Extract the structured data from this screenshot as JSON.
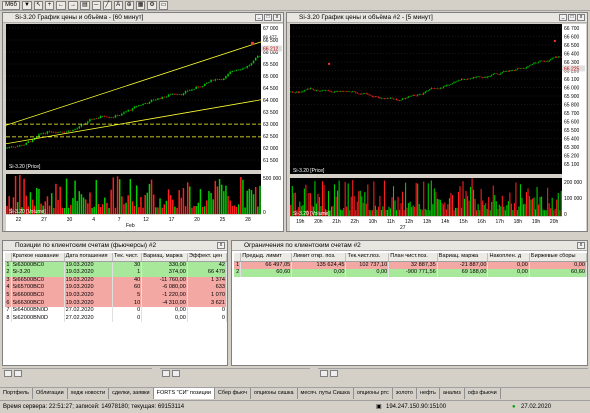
{
  "toolbar": {
    "instrument": "M6б"
  },
  "chart1": {
    "title": "Si-3.20 График цены и объёма - [60 минут]",
    "price_legend": "Si-3.20 [Price]",
    "volume_legend": "Si-3.20 [Volume]",
    "y_ticks": [
      "67 000",
      "66 500",
      "66 000",
      "65 500",
      "65 000",
      "64 500",
      "64 000",
      "63 500",
      "63 000",
      "62 500",
      "62 000",
      "61 500"
    ],
    "last_price": "66 212",
    "prev_price": "66 477",
    "vol_ticks": [
      "500 000",
      "0"
    ],
    "x_ticks": [
      "22",
      "27",
      "30",
      "4",
      "7",
      "12",
      "17",
      "20",
      "25",
      "28"
    ],
    "month_label": "Feb"
  },
  "chart2": {
    "title": "Si-3.20 График цены и объёма #2 - [5 минут]",
    "price_legend": "Si-3.20 [Price]",
    "volume_legend": "Si-3.20 [Volume]",
    "y_ticks": [
      "66 700",
      "66 600",
      "66 500",
      "66 400",
      "66 300",
      "66 200",
      "66 100",
      "66 000",
      "65 900",
      "65 800",
      "65 700",
      "65 600",
      "65 500",
      "65 400",
      "65 300",
      "65 200",
      "65 100"
    ],
    "last_price": "66 225",
    "vol_ticks": [
      "200 000",
      "100 000",
      "0"
    ],
    "x_ticks": [
      "19h",
      "20h",
      "21h",
      "22h",
      "10h",
      "11h",
      "12h",
      "13h",
      "14h",
      "15h",
      "16h",
      "17h",
      "18h",
      "19h",
      "20h"
    ],
    "day_label": "27"
  },
  "positions": {
    "title": "Позиции по клиентским счетам (фьючерсы) #2",
    "columns": [
      "",
      "Краткое название",
      "Дата погашения",
      "Тек. чист.",
      "Вариац. маржа",
      "Эффект. цен"
    ],
    "rows": [
      {
        "n": "1",
        "name": "Si63000BC0",
        "date": "19.03.2020",
        "pos": "30",
        "margin": "330,00",
        "eff": "42",
        "color": "#a8e89a"
      },
      {
        "n": "2",
        "name": "Si-3.20",
        "date": "19.03.2020",
        "pos": "1",
        "margin": "374,00",
        "eff": "66 479",
        "color": "#a8e89a"
      },
      {
        "n": "3",
        "name": "Si66500BC0",
        "date": "19.03.2020",
        "pos": "40",
        "margin": "-11 760,00",
        "eff": "1 374",
        "color": "#f4a8a4"
      },
      {
        "n": "4",
        "name": "Si65700BC0",
        "date": "19.03.2020",
        "pos": "60",
        "margin": "-6 080,00",
        "eff": "633",
        "color": "#f4a8a4"
      },
      {
        "n": "5",
        "name": "Si66000BC0",
        "date": "19.03.2020",
        "pos": "5",
        "margin": "-1 220,00",
        "eff": "1 070",
        "color": "#f4a8a4"
      },
      {
        "n": "6",
        "name": "Si66300BC0",
        "date": "19.03.2020",
        "pos": "10",
        "margin": "-4 310,00",
        "eff": "3 621",
        "color": "#f4a8a4"
      },
      {
        "n": "7",
        "name": "Si64000BN0D",
        "date": "27.02.2020",
        "pos": "0",
        "margin": "0,00",
        "eff": "0",
        "color": "#ffffff"
      },
      {
        "n": "8",
        "name": "Si62000BN0D",
        "date": "27.02.2020",
        "pos": "0",
        "margin": "0,00",
        "eff": "0",
        "color": "#ffffff"
      }
    ]
  },
  "limits": {
    "title": "Ограничения по клиентским счетам #2",
    "columns": [
      "",
      "Предыд. лимит",
      "Лимит откр. поз.",
      "Тек.чист.поз.",
      "План чист.поз.",
      "Вариац. маржа",
      "Накоплен. д",
      "Биржевые сборы"
    ],
    "rows": [
      {
        "n": "1",
        "a": "66 497,05",
        "b": "135 624,45",
        "c": "102 737,10",
        "d": "32 887,35",
        "e": "-21 887,00",
        "f": "0,00",
        "g": "0,00",
        "color": "#f4a8a4"
      },
      {
        "n": "2",
        "a": "60,60",
        "b": "0,00",
        "c": "0,00",
        "d": "-900 771,56",
        "e": "69 188,00",
        "f": "0,00",
        "g": "60,60",
        "color": "#a8e89a"
      }
    ]
  },
  "tabs": [
    {
      "label": "Портфель",
      "active": false
    },
    {
      "label": "Облигации",
      "active": false
    },
    {
      "label": "хедж новости",
      "active": false
    },
    {
      "label": "сделки, заявки",
      "active": false
    },
    {
      "label": "FORTS \"СИ\" позиции",
      "active": true
    },
    {
      "label": "Сбер фьюч",
      "active": false
    },
    {
      "label": "опционы сишка",
      "active": false
    },
    {
      "label": "месяч. путы Сишка",
      "active": false
    },
    {
      "label": "опционы ртс",
      "active": false
    },
    {
      "label": "золото",
      "active": false
    },
    {
      "label": "нефть",
      "active": false
    },
    {
      "label": "анализ",
      "active": false
    },
    {
      "label": "офз фьючи",
      "active": false
    }
  ],
  "status": {
    "server_time": "Время сервера: 22:51:27; записей: 14978180; текущая: 69153114",
    "ip": "194.247.150.90:15100",
    "date": "27.02.2020"
  },
  "colors": {
    "green": "#00c000",
    "red": "#ff2020",
    "yellow": "#ffff40",
    "chart_bg": "#000000"
  }
}
